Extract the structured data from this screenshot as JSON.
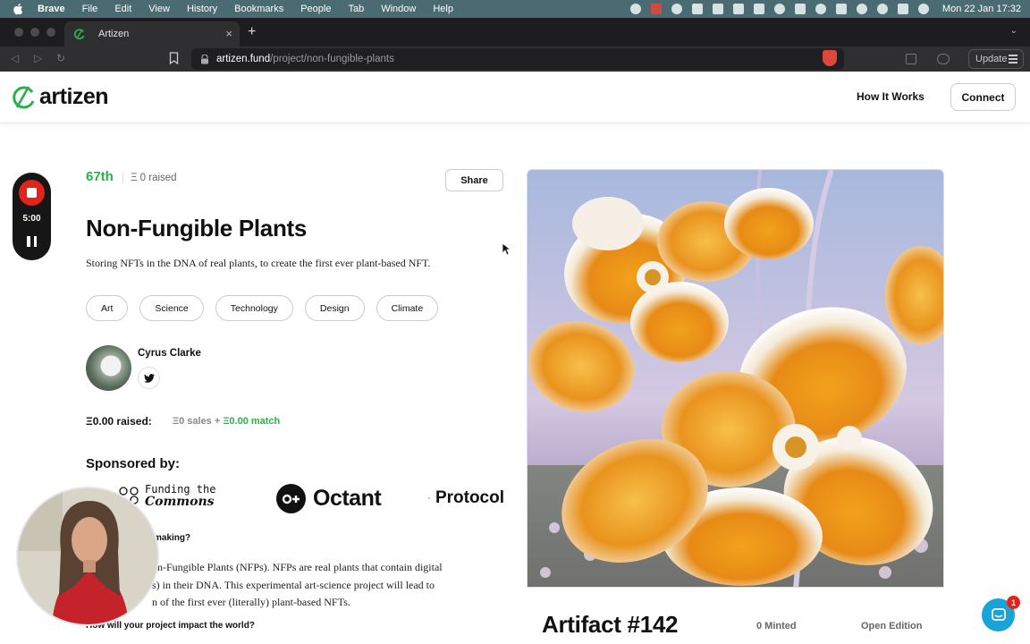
{
  "menubar": {
    "app": "Brave",
    "items": [
      "File",
      "Edit",
      "View",
      "History",
      "Bookmarks",
      "People",
      "Tab",
      "Window",
      "Help"
    ],
    "clock": "Mon 22 Jan  17:32"
  },
  "browser": {
    "tab_title": "Artizen",
    "url_host": "artizen.fund",
    "url_path": "/project/non-fungible-plants",
    "update_label": "Update"
  },
  "site": {
    "logo_text": "artizen",
    "nav_how": "How It Works",
    "nav_connect": "Connect",
    "brand_green": "#2ab14b"
  },
  "recorder": {
    "time": "5:00"
  },
  "project": {
    "rank": "67th",
    "raised_top": "Ξ 0 raised",
    "share_label": "Share",
    "title": "Non-Fungible Plants",
    "description": "Storing NFTs in the DNA of real plants, to create the first ever plant-based NFT.",
    "tags": [
      "Art",
      "Science",
      "Technology",
      "Design",
      "Climate"
    ],
    "creator": "Cyrus Clarke",
    "raised_label": "Ξ0.00 raised:",
    "raised_sales": "Ξ0 sales + ",
    "raised_match": "Ξ0.00 match",
    "sponsored_heading": "Sponsored by:",
    "sponsors": {
      "ftc_line1": "Funding the",
      "ftc_line2": "Commons",
      "octant": "Octant",
      "proto": "Protocol"
    },
    "question1": "making?",
    "body_lines": [
      "on-Fungible Plants (NFPs). NFPs are real plants that contain digital",
      "s) in their DNA. This experimental art-science project will lead to",
      "n of the first ever (literally) plant-based NFTs."
    ],
    "question2": "How will your project impact the world?"
  },
  "artifact": {
    "title": "Artifact #142",
    "minted": "0 Minted",
    "edition": "Open Edition"
  },
  "chat": {
    "badge": "1"
  }
}
